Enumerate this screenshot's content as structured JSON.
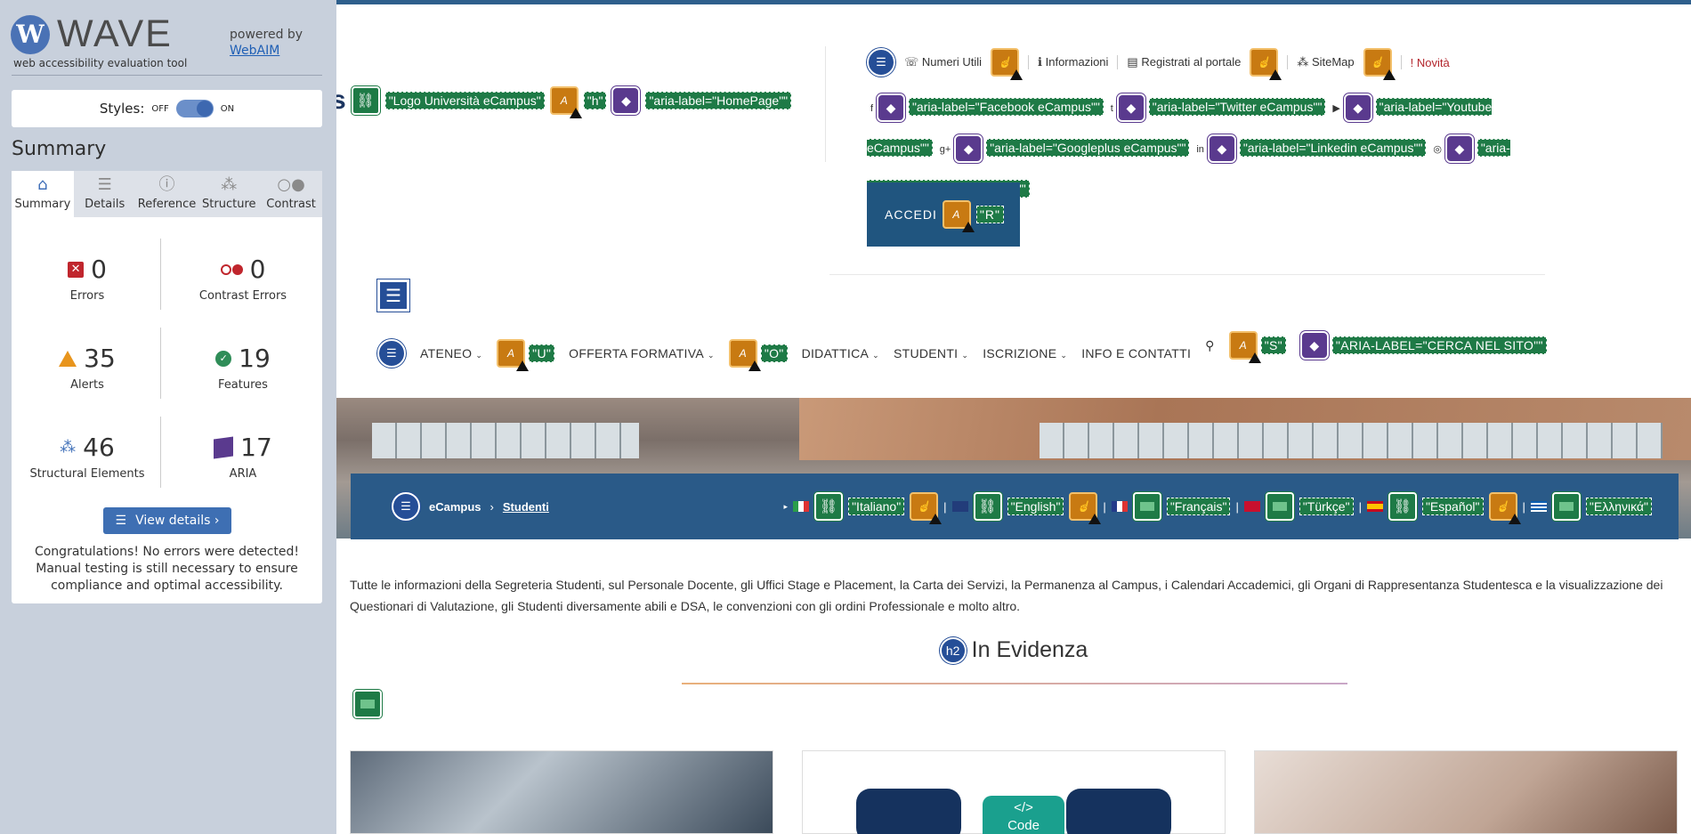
{
  "wave": {
    "title": "WAVE",
    "tagline": "web accessibility evaluation tool",
    "powered_by": "powered by",
    "webaim": "WebAIM",
    "styles_label": "Styles:",
    "styles_off": "OFF",
    "styles_on": "ON",
    "summary_title": "Summary",
    "tabs": [
      "Summary",
      "Details",
      "Reference",
      "Structure",
      "Contrast"
    ],
    "stats": {
      "errors": {
        "count": "0",
        "label": "Errors"
      },
      "contrast": {
        "count": "0",
        "label": "Contrast Errors"
      },
      "alerts": {
        "count": "35",
        "label": "Alerts"
      },
      "features": {
        "count": "19",
        "label": "Features"
      },
      "structural": {
        "count": "46",
        "label": "Structural Elements"
      },
      "aria": {
        "count": "17",
        "label": "ARIA"
      }
    },
    "view_details": "View details ›",
    "congrats": "Congratulations! No errors were detected! Manual testing is still necessary to ensure compliance and optimal accessibility."
  },
  "page": {
    "logo_alt": "\"Logo Università eCampus\"",
    "logo_h": "\"h\"",
    "home_aria": "\"aria-label=\"HomePage\"\"",
    "util": [
      "Numeri Utili",
      "Informazioni",
      "Registrati al portale",
      "SiteMap",
      "Novità"
    ],
    "social": [
      "\"aria-label=\"Facebook eCampus\"\"",
      "\"aria-label=\"Twitter eCampus\"\"",
      "\"aria-label=\"Youtube eCampus\"\"",
      "\"aria-label=\"Googleplus eCampus\"\"",
      "\"aria-label=\"Linkedin eCampus\"\"",
      "\"aria-label=\"Instagram eCampus\"\""
    ],
    "accedi": "ACCEDI",
    "accedi_tag": "\"R\"",
    "nav": [
      "ATENEO",
      "OFFERTA FORMATIVA",
      "DIDATTICA",
      "STUDENTI",
      "ISCRIZIONE",
      "INFO E CONTATTI"
    ],
    "nav_tag_u": "\"U\"",
    "nav_tag_o": "\"O\"",
    "search_tag": "\"S\"",
    "search_aria": "\"ARIA-LABEL=\"CERCA NEL SITO\"\"",
    "breadcrumb": [
      "eCampus",
      "Studenti"
    ],
    "languages": [
      "\"Italiano\"",
      "\"English\"",
      "\"Français\"",
      "\"Türkçe\"",
      "\"Español\"",
      "\"Ελληνικά\""
    ],
    "intro": "Tutte le informazioni della Segreteria Studenti, sul Personale Docente, gli Uffici Stage e Placement, la Carta dei Servizi, la Permanenza al Campus, i Calendari Accademici, gli Organi di Rappresentanza Studentesca e la visualizzazione dei Questionari di Valutazione, gli Studenti diversamente abili e DSA, le convenzioni con gli ordini Professionale e molto altro.",
    "section_title": "In Evidenza",
    "h2": "h2",
    "code_label": "Code"
  }
}
